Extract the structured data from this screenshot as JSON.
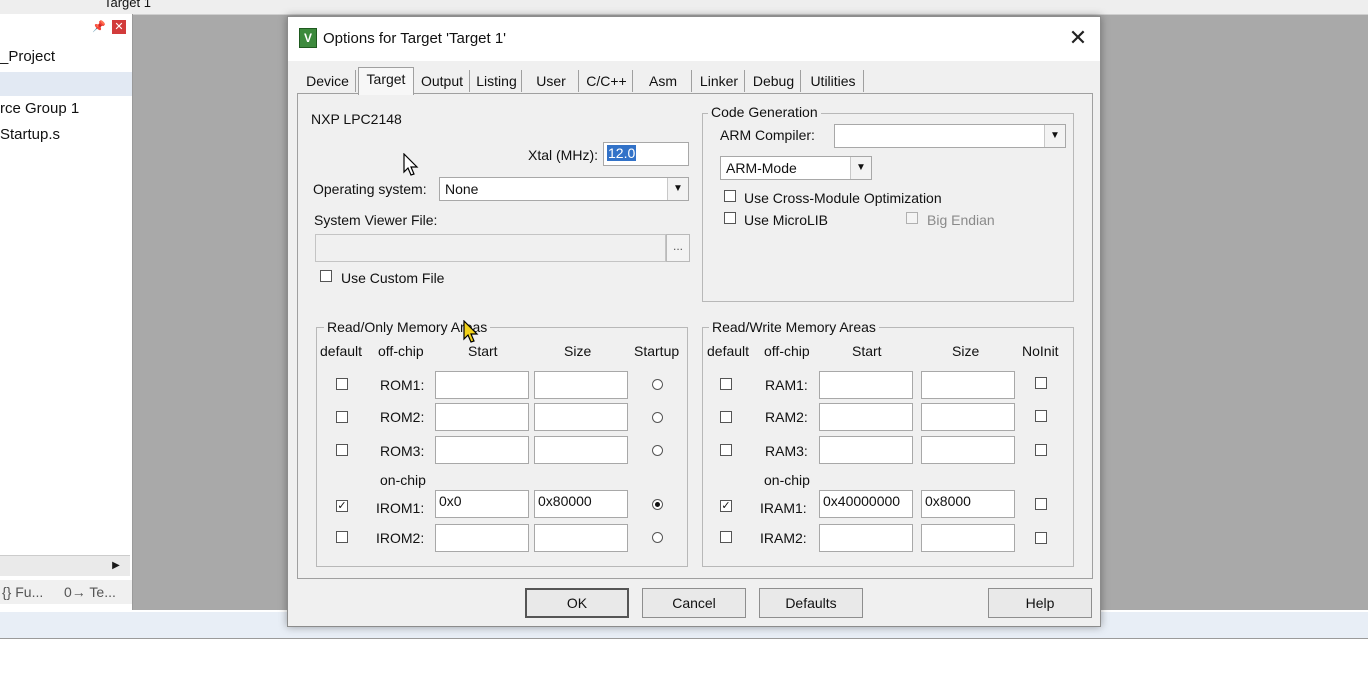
{
  "ide": {
    "toolbar_target": "Target 1",
    "tree": [
      "_Project",
      "rce Group 1",
      "Startup.s"
    ],
    "bottom_tabs": [
      "{} Fu...",
      "0→ Te..."
    ]
  },
  "dialog": {
    "title": "Options for Target 'Target 1'",
    "close_label": "✕",
    "tabs": [
      "Device",
      "Target",
      "Output",
      "Listing",
      "User",
      "C/C++",
      "Asm",
      "Linker",
      "Debug",
      "Utilities"
    ],
    "active_tab": "Target",
    "device": "NXP LPC2148",
    "xtal_label": "Xtal (MHz):",
    "xtal_value": "12.0",
    "os_label": "Operating system:",
    "os_value": "None",
    "svf_label": "System Viewer File:",
    "svf_value": "",
    "browse_label": "...",
    "use_custom_file": "Use Custom File",
    "code_gen": {
      "title": "Code Generation",
      "compiler_label": "ARM Compiler:",
      "compiler_value": "",
      "mode_value": "ARM-Mode",
      "cross_module": "Use Cross-Module Optimization",
      "microlib": "Use MicroLIB",
      "big_endian": "Big Endian"
    },
    "ro_mem": {
      "title": "Read/Only Memory Areas",
      "headers": [
        "default",
        "off-chip",
        "Start",
        "Size",
        "Startup"
      ],
      "onchip_label": "on-chip",
      "rows": [
        {
          "name": "ROM1:",
          "start": "",
          "size": "",
          "default": false,
          "startup": false
        },
        {
          "name": "ROM2:",
          "start": "",
          "size": "",
          "default": false,
          "startup": false
        },
        {
          "name": "ROM3:",
          "start": "",
          "size": "",
          "default": false,
          "startup": false
        },
        {
          "name": "IROM1:",
          "start": "0x0",
          "size": "0x80000",
          "default": true,
          "startup": true
        },
        {
          "name": "IROM2:",
          "start": "",
          "size": "",
          "default": false,
          "startup": false
        }
      ]
    },
    "rw_mem": {
      "title": "Read/Write Memory Areas",
      "headers": [
        "default",
        "off-chip",
        "Start",
        "Size",
        "NoInit"
      ],
      "onchip_label": "on-chip",
      "rows": [
        {
          "name": "RAM1:",
          "start": "",
          "size": "",
          "default": false,
          "noinit": false
        },
        {
          "name": "RAM2:",
          "start": "",
          "size": "",
          "default": false,
          "noinit": false
        },
        {
          "name": "RAM3:",
          "start": "",
          "size": "",
          "default": false,
          "noinit": false
        },
        {
          "name": "IRAM1:",
          "start": "0x40000000",
          "size": "0x8000",
          "default": true,
          "noinit": false
        },
        {
          "name": "IRAM2:",
          "start": "",
          "size": "",
          "default": false,
          "noinit": false
        }
      ]
    },
    "buttons": {
      "ok": "OK",
      "cancel": "Cancel",
      "defaults": "Defaults",
      "help": "Help"
    }
  },
  "colors": {
    "selection": "#3272c8",
    "dialog_bg": "#f0f0f0",
    "ide_bg": "#a9a9a9"
  }
}
